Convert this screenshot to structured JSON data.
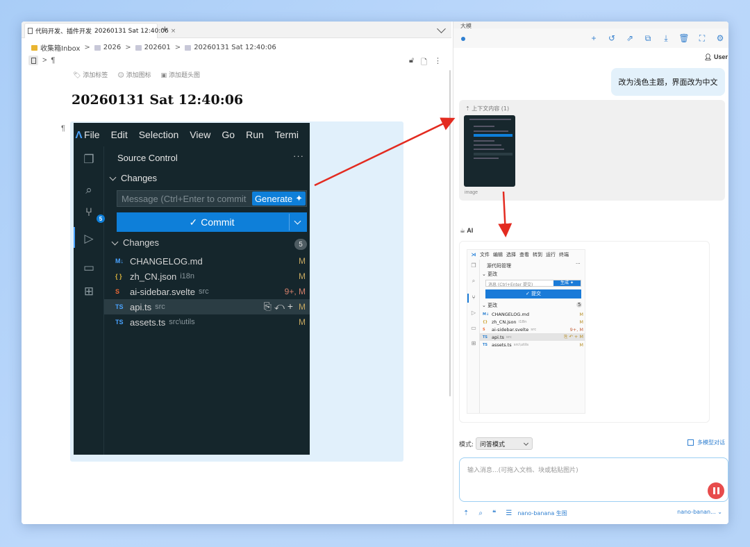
{
  "tab": {
    "title": "代码开发、插件开发",
    "doc": "20260131 Sat 12:40:06"
  },
  "breadcrumb": {
    "items": [
      "收集箱Inbox",
      "2026",
      "202601",
      "20260131 Sat 12:40:06"
    ]
  },
  "doc": {
    "pilcrow": "¶",
    "add_tag": "添加标签",
    "add_icon": "添加图标",
    "add_cover": "添加题头图",
    "title": "20260131 Sat 12:40:06"
  },
  "vscode": {
    "menu": [
      "File",
      "Edit",
      "Selection",
      "View",
      "Go",
      "Run",
      "Termi"
    ],
    "panel_title": "Source Control",
    "changes_header": "Changes",
    "message_placeholder": "Message (Ctrl+Enter to commit",
    "generate_label": "Generate",
    "commit_label": "Commit",
    "changes_group": "Changes",
    "changes_count": "5",
    "scm_badge": "5",
    "files": [
      {
        "icon": "M↓",
        "name": "CHANGELOG.md",
        "dir": "",
        "status": "M"
      },
      {
        "icon": "{ }",
        "name": "zh_CN.json",
        "dir": "i18n",
        "status": "M"
      },
      {
        "icon": "S",
        "name": "ai-sidebar.svelte",
        "dir": "src",
        "status": "9+, M"
      },
      {
        "icon": "TS",
        "name": "api.ts",
        "dir": "src",
        "status": "M"
      },
      {
        "icon": "TS",
        "name": "assets.ts",
        "dir": "src\\utils",
        "status": "M"
      }
    ]
  },
  "panel": {
    "header_text": "大模",
    "user_label": "User",
    "user_message": "改为浅色主题，界面改为中文",
    "context_title": "上下文内容 (1)",
    "context_caption": "image",
    "ai_label": "AI",
    "mode_label": "模式:",
    "mode_value": "问答模式",
    "multi_model": "多模型对话",
    "input_placeholder": "输入消息...(可拖入文档、块或粘贴图片)",
    "model_tool": "nano-banana 生图",
    "model_select": "nano-banan..."
  },
  "light_vscode": {
    "menu": [
      "文件",
      "编辑",
      "选择",
      "查看",
      "转到",
      "运行",
      "终端"
    ],
    "panel_title": "源代码管理",
    "changes_header": "更改",
    "message_placeholder": "消息 (Ctrl+Enter 提交)",
    "generate_label": "生成",
    "commit_label": "提交",
    "changes_group": "更改",
    "changes_count": "5",
    "files": [
      {
        "icon": "M↓",
        "name": "CHANGELOG.md",
        "dir": "",
        "status": "M"
      },
      {
        "icon": "{}",
        "name": "zh_CN.json",
        "dir": "i18n",
        "status": "M"
      },
      {
        "icon": "S",
        "name": "ai-sidebar.svelte",
        "dir": "src",
        "status": "9+, M"
      },
      {
        "icon": "TS",
        "name": "api.ts",
        "dir": "src",
        "status": "M"
      },
      {
        "icon": "TS",
        "name": "assets.ts",
        "dir": "src\\utils",
        "status": "M"
      }
    ]
  },
  "colors": {
    "accent": "#2f7fd0",
    "vscode_bg": "#15262c",
    "vscode_blue": "#0e7fd9",
    "arrow": "#e32b20",
    "stop": "#e74c4c"
  }
}
